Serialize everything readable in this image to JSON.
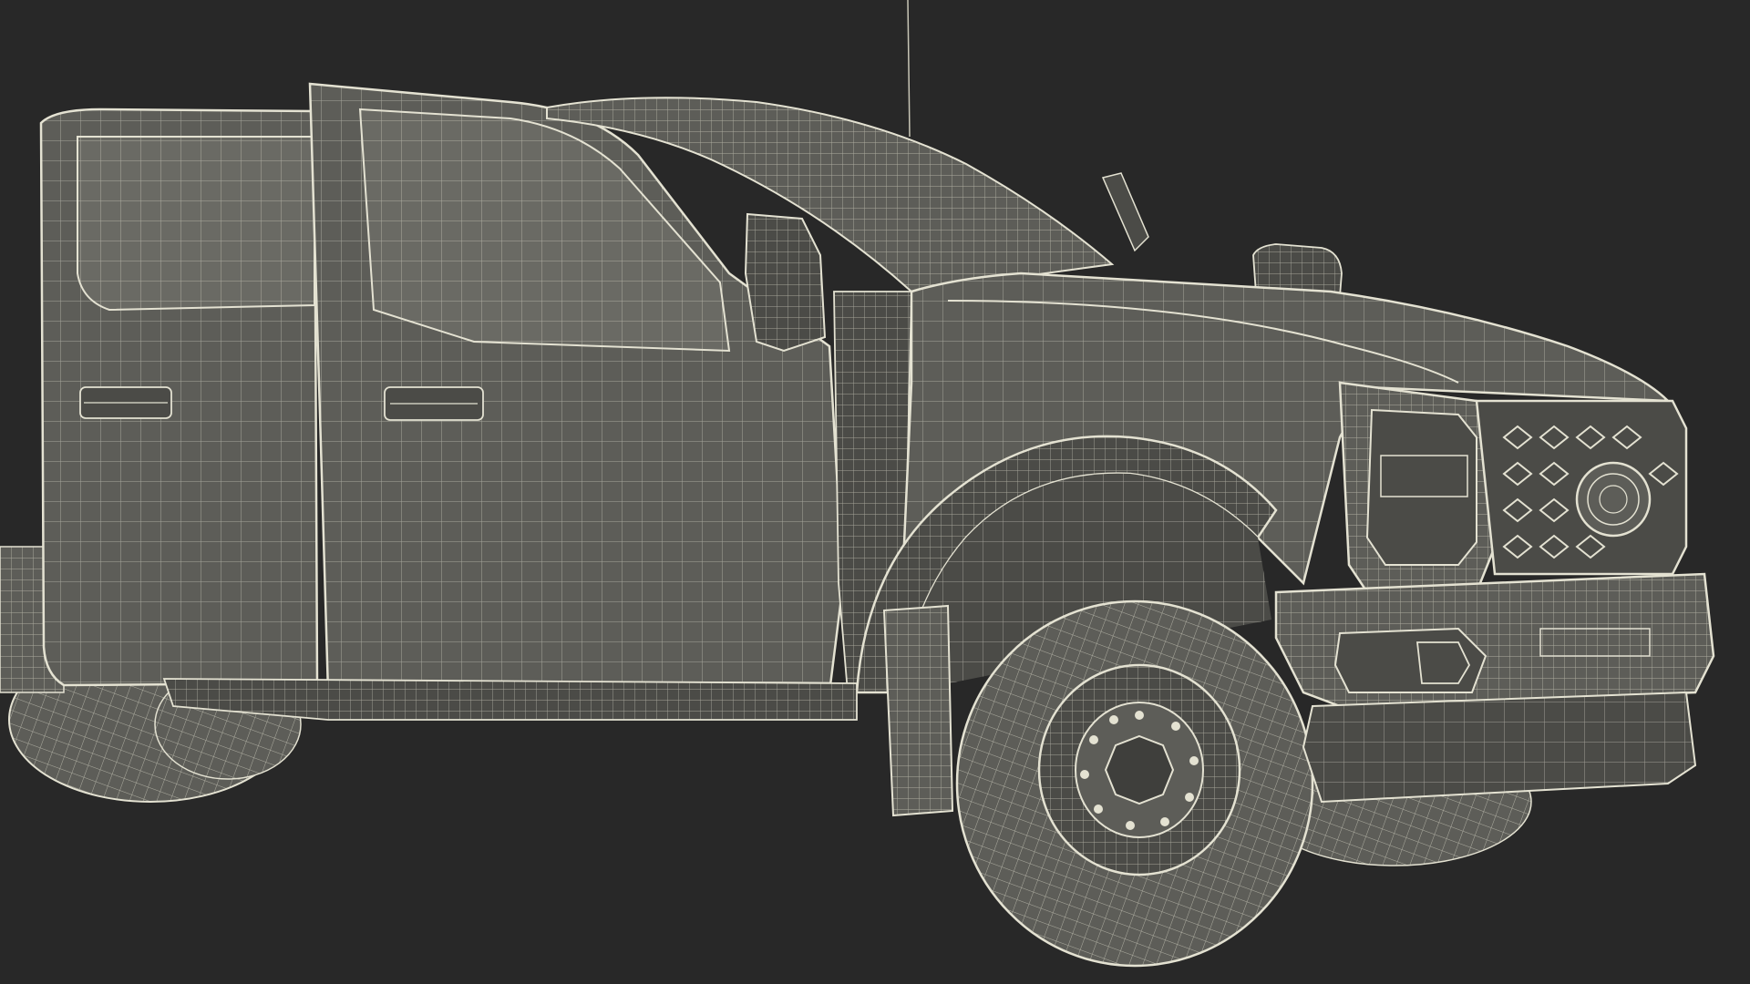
{
  "scene": {
    "background_color": "#282828",
    "surface_color": "#5d5d58",
    "surface_light_color": "#6a6a64",
    "surface_dark_color": "#4b4b47",
    "wire_color": "#e4e2d2",
    "wire_dim_color": "#c8c6b6",
    "subject": "pickup-truck-wireframe"
  }
}
